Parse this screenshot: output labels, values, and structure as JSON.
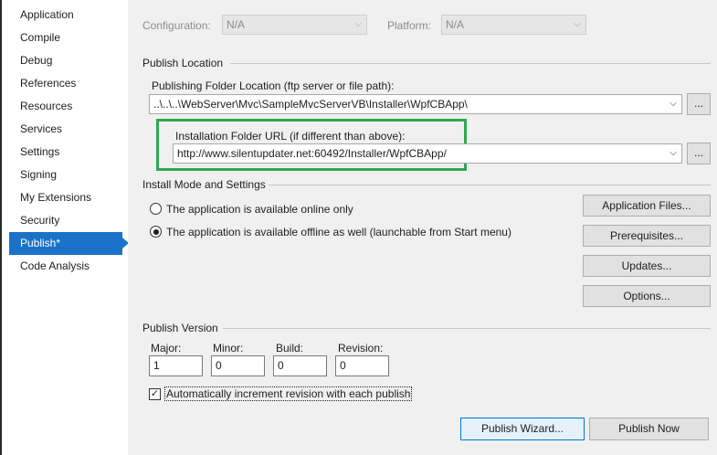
{
  "sidebar": {
    "items": [
      {
        "label": "Application"
      },
      {
        "label": "Compile"
      },
      {
        "label": "Debug"
      },
      {
        "label": "References"
      },
      {
        "label": "Resources"
      },
      {
        "label": "Services"
      },
      {
        "label": "Settings"
      },
      {
        "label": "Signing"
      },
      {
        "label": "My Extensions"
      },
      {
        "label": "Security"
      },
      {
        "label": "Publish*"
      },
      {
        "label": "Code Analysis"
      }
    ],
    "active_label": "Publish*"
  },
  "top": {
    "configuration_label": "Configuration:",
    "configuration_value": "N/A",
    "platform_label": "Platform:",
    "platform_value": "N/A"
  },
  "publish_location": {
    "section_title": "Publish Location",
    "folder_label": "Publishing Folder Location (ftp server or file path):",
    "folder_value": "..\\..\\..\\WebServer\\Mvc\\SampleMvcServerVB\\Installer\\WpfCBApp\\",
    "url_label": "Installation Folder URL (if different than above):",
    "url_value": "http://www.silentupdater.net:60492/Installer/WpfCBApp/",
    "browse_label": "..."
  },
  "install_mode": {
    "section_title": "Install Mode and Settings",
    "online_label": "The application is available online only",
    "offline_label": "The application is available offline as well (launchable from Start menu)",
    "selected": "offline",
    "buttons": {
      "application_files": "Application Files...",
      "prerequisites": "Prerequisites...",
      "updates": "Updates...",
      "options": "Options..."
    }
  },
  "publish_version": {
    "section_title": "Publish Version",
    "major_label": "Major:",
    "minor_label": "Minor:",
    "build_label": "Build:",
    "revision_label": "Revision:",
    "major": "1",
    "minor": "0",
    "build": "0",
    "revision": "0",
    "auto_increment_label": "Automatically increment revision with each publish",
    "auto_increment_checked": true
  },
  "footer": {
    "wizard_label": "Publish Wizard...",
    "publish_now_label": "Publish Now"
  },
  "colors": {
    "accent": "#1a73c8",
    "highlight": "#2fa84f"
  },
  "icons": {
    "dropdown": "chevron-down-icon",
    "check": "checkmark-icon"
  }
}
